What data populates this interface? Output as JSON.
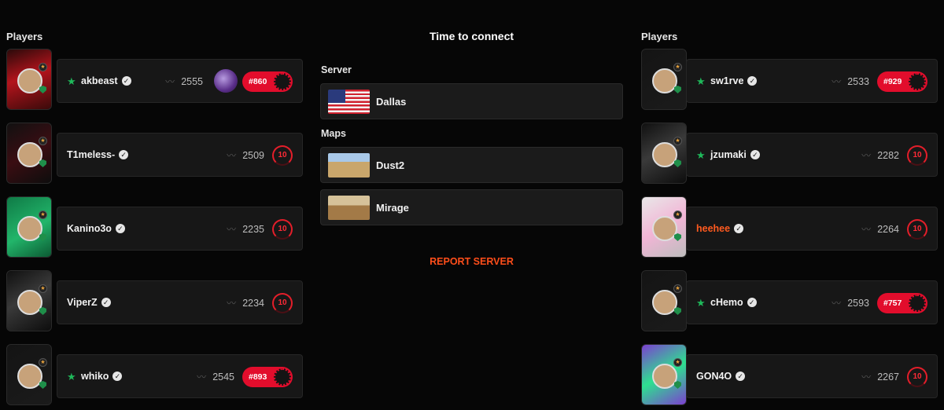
{
  "left_team": {
    "title": "Players",
    "players": [
      {
        "name": "akbeast",
        "elo": "2555",
        "rank": "#860",
        "badge": "rank-pill",
        "star": true,
        "avatar_art": "red-character"
      },
      {
        "name": "T1meless-",
        "elo": "2509",
        "level": "10",
        "badge": "level",
        "star": false,
        "avatar_art": "anime-red"
      },
      {
        "name": "Kanino3o",
        "elo": "2235",
        "level": "10",
        "badge": "level",
        "star": false,
        "avatar_art": "green-portrait"
      },
      {
        "name": "ViperZ",
        "elo": "2234",
        "level": "10",
        "badge": "level",
        "star": false,
        "avatar_art": "dark-metal"
      },
      {
        "name": "whiko",
        "elo": "2545",
        "rank": "#893",
        "badge": "rank-pill",
        "star": true,
        "avatar_art": "dark-portrait"
      }
    ]
  },
  "right_team": {
    "title": "Players",
    "players": [
      {
        "name": "sw1rve",
        "elo": "2533",
        "rank": "#929",
        "badge": "rank-pill",
        "star": true,
        "avatar_art": "dark-portrait"
      },
      {
        "name": "jzumaki",
        "elo": "2282",
        "level": "10",
        "badge": "level",
        "star": true,
        "avatar_art": "dark-metal"
      },
      {
        "name": "heehee",
        "elo": "2264",
        "level": "10",
        "badge": "level",
        "star": false,
        "name_color": "#ff5a1f",
        "avatar_art": "anime-pink"
      },
      {
        "name": "cHemo",
        "elo": "2593",
        "rank": "#757",
        "badge": "rank-pill",
        "star": true,
        "avatar_art": "dark-portrait"
      },
      {
        "name": "GON4O",
        "elo": "2267",
        "level": "10",
        "badge": "level",
        "star": false,
        "avatar_art": "green-purple-meme"
      }
    ]
  },
  "center": {
    "title": "Time to connect",
    "server_label": "Server",
    "server": {
      "name": "Dallas",
      "flag": "us-flag"
    },
    "maps_label": "Maps",
    "maps": [
      {
        "name": "Dust2",
        "thumb": "dust2-thumb"
      },
      {
        "name": "Mirage",
        "thumb": "mirage-thumb"
      }
    ],
    "report_label": "REPORT SERVER"
  },
  "colors": {
    "accent_red": "#e20d2c",
    "report_orange": "#ff4e1a",
    "verified_green": "#1fb85a",
    "background": "#060606"
  }
}
